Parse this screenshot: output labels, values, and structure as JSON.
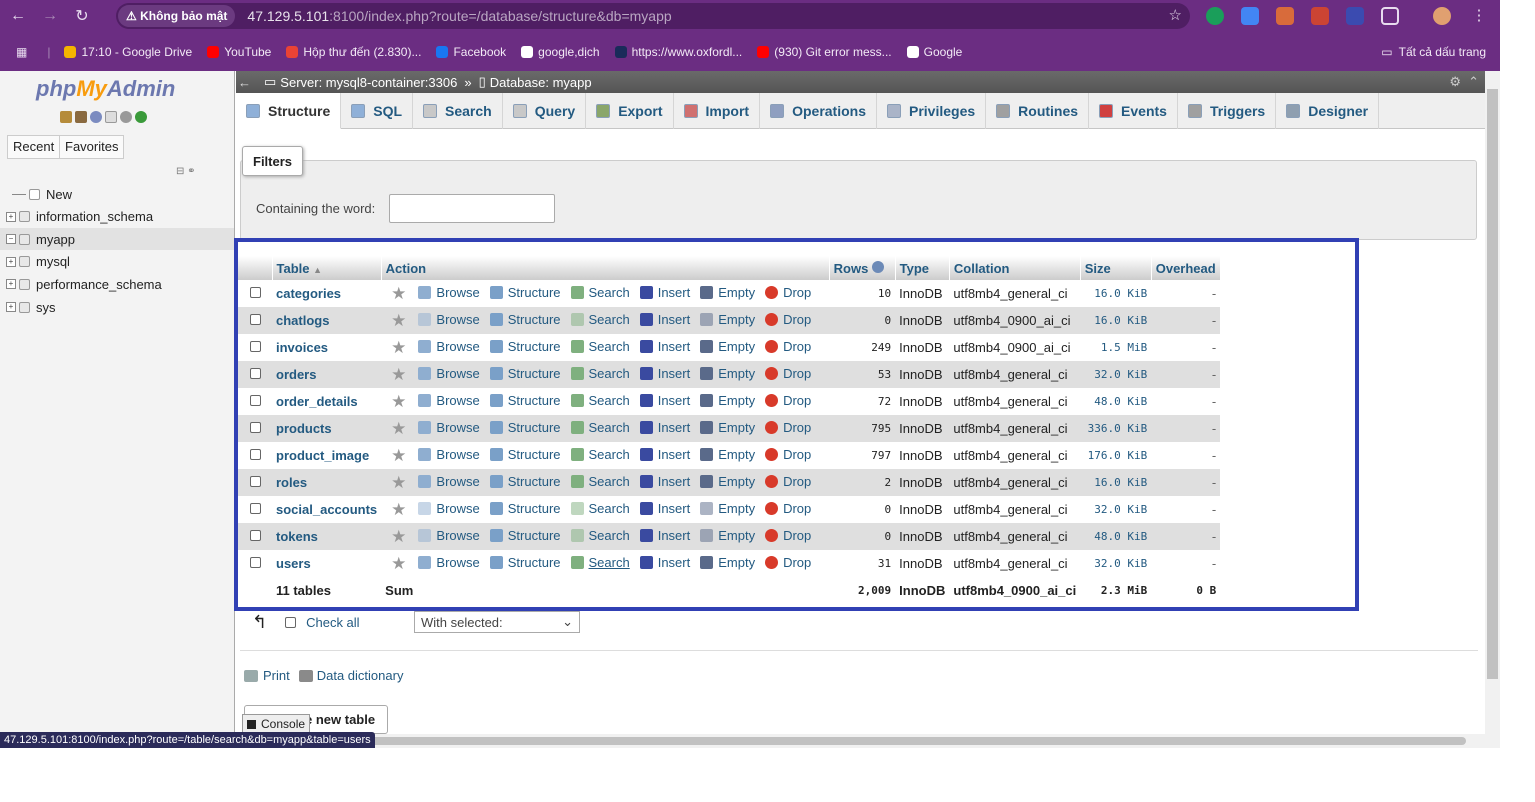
{
  "browser": {
    "insecure_label": "Không bảo mật",
    "url_host": "47.129.5.101",
    "url_rest": ":8100/index.php?route=/database/structure&db=myapp",
    "bookmarks": [
      {
        "label": "17:10 - Google Drive",
        "color": "#f4b400"
      },
      {
        "label": "YouTube",
        "color": "#ff0000"
      },
      {
        "label": "Hộp thư đến (2.830)...",
        "color": "#ea4335"
      },
      {
        "label": "Facebook",
        "color": "#1877f2"
      },
      {
        "label": "google,dịch",
        "color": "#ffffff"
      },
      {
        "label": "https://www.oxfordl...",
        "color": "#1a2b5a"
      },
      {
        "label": "(930) Git error mess...",
        "color": "#ff0000"
      },
      {
        "label": "Google",
        "color": "#ffffff"
      }
    ],
    "all_bookmarks": "Tất cả dấu trang",
    "status_url": "47.129.5.101:8100/index.php?route=/table/search&db=myapp&table=users"
  },
  "sidebar": {
    "logo": {
      "php": "php",
      "my": "My",
      "admin": "Admin"
    },
    "tabs": [
      "Recent",
      "Favorites"
    ],
    "tree": [
      {
        "label": "New",
        "type": "new"
      },
      {
        "label": "information_schema",
        "type": "db"
      },
      {
        "label": "myapp",
        "type": "db",
        "selected": true
      },
      {
        "label": "mysql",
        "type": "db"
      },
      {
        "label": "performance_schema",
        "type": "db"
      },
      {
        "label": "sys",
        "type": "db"
      }
    ]
  },
  "breadcrumb": {
    "server": "Server: mysql8-container:3306",
    "database": "Database: myapp"
  },
  "tabs": [
    "Structure",
    "SQL",
    "Search",
    "Query",
    "Export",
    "Import",
    "Operations",
    "Privileges",
    "Routines",
    "Events",
    "Triggers",
    "Designer"
  ],
  "active_tab": "Structure",
  "filters": {
    "legend": "Filters",
    "label": "Containing the word:",
    "value": ""
  },
  "table": {
    "headers": {
      "table": "Table",
      "action": "Action",
      "rows": "Rows",
      "type": "Type",
      "collation": "Collation",
      "size": "Size",
      "overhead": "Overhead"
    },
    "actions": [
      "Browse",
      "Structure",
      "Search",
      "Insert",
      "Empty",
      "Drop"
    ],
    "rows": [
      {
        "name": "categories",
        "rows": "10",
        "type": "InnoDB",
        "collation": "utf8mb4_general_ci",
        "size": "16.0 KiB",
        "overhead": "-",
        "empty": false
      },
      {
        "name": "chatlogs",
        "rows": "0",
        "type": "InnoDB",
        "collation": "utf8mb4_0900_ai_ci",
        "size": "16.0 KiB",
        "overhead": "-",
        "empty": true
      },
      {
        "name": "invoices",
        "rows": "249",
        "type": "InnoDB",
        "collation": "utf8mb4_0900_ai_ci",
        "size": "1.5 MiB",
        "overhead": "-",
        "empty": false
      },
      {
        "name": "orders",
        "rows": "53",
        "type": "InnoDB",
        "collation": "utf8mb4_general_ci",
        "size": "32.0 KiB",
        "overhead": "-",
        "empty": false
      },
      {
        "name": "order_details",
        "rows": "72",
        "type": "InnoDB",
        "collation": "utf8mb4_general_ci",
        "size": "48.0 KiB",
        "overhead": "-",
        "empty": false
      },
      {
        "name": "products",
        "rows": "795",
        "type": "InnoDB",
        "collation": "utf8mb4_general_ci",
        "size": "336.0 KiB",
        "overhead": "-",
        "empty": false
      },
      {
        "name": "product_image",
        "rows": "797",
        "type": "InnoDB",
        "collation": "utf8mb4_general_ci",
        "size": "176.0 KiB",
        "overhead": "-",
        "empty": false
      },
      {
        "name": "roles",
        "rows": "2",
        "type": "InnoDB",
        "collation": "utf8mb4_general_ci",
        "size": "16.0 KiB",
        "overhead": "-",
        "empty": false
      },
      {
        "name": "social_accounts",
        "rows": "0",
        "type": "InnoDB",
        "collation": "utf8mb4_general_ci",
        "size": "32.0 KiB",
        "overhead": "-",
        "empty": true
      },
      {
        "name": "tokens",
        "rows": "0",
        "type": "InnoDB",
        "collation": "utf8mb4_general_ci",
        "size": "48.0 KiB",
        "overhead": "-",
        "empty": true
      },
      {
        "name": "users",
        "rows": "31",
        "type": "InnoDB",
        "collation": "utf8mb4_general_ci",
        "size": "32.0 KiB",
        "overhead": "-",
        "empty": false
      }
    ],
    "summary": {
      "count": "11 tables",
      "label": "Sum",
      "rows": "2,009",
      "type": "InnoDB",
      "collation": "utf8mb4_0900_ai_ci",
      "size": "2.3 MiB",
      "overhead": "0 B"
    }
  },
  "bottom": {
    "check_all": "Check all",
    "with_selected": "With selected:",
    "print": "Print",
    "data_dictionary": "Data dictionary",
    "create_table": "e new table",
    "console": "Console"
  },
  "colors": {
    "link": "#235a81",
    "highlight": "#3140b4",
    "chrome": "#6b2d82"
  }
}
